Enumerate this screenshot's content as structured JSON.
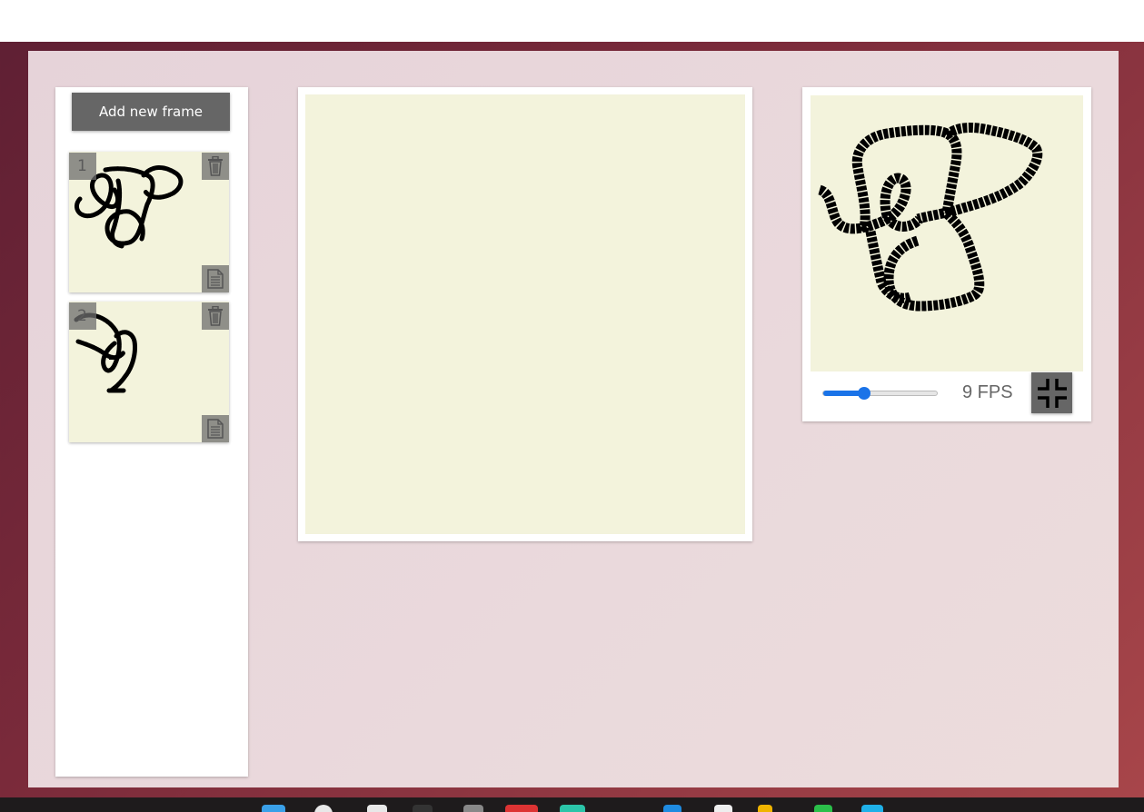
{
  "frames_panel": {
    "add_frame_label": "Add new frame",
    "frames": [
      {
        "number": "1"
      },
      {
        "number": "2"
      }
    ]
  },
  "preview": {
    "fps_value": 9,
    "fps_label": "9 FPS",
    "fps_slider_fraction": 0.36
  },
  "colors": {
    "canvas_bg": "#f3f3dc",
    "button_gray": "#666666",
    "accent": "#1a73e8",
    "stroke": "#000000"
  },
  "icons": {
    "delete": "trash-icon",
    "duplicate": "document-icon",
    "fullscreen_exit": "exit-fullscreen-icon"
  }
}
